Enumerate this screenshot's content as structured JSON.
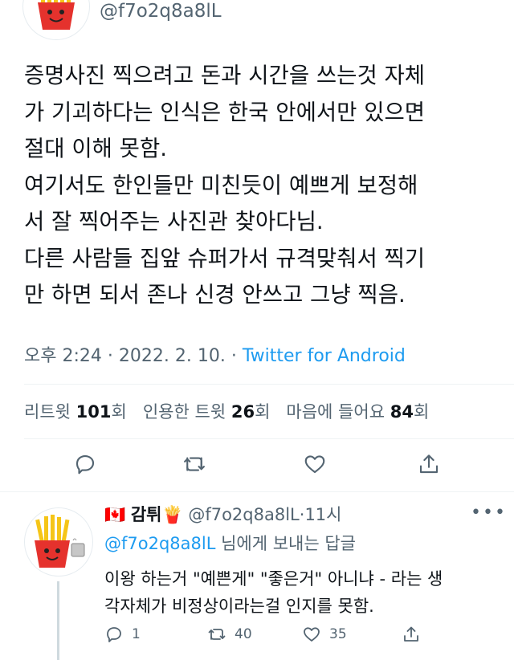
{
  "main_tweet": {
    "handle": "@f7o2q8a8lL",
    "body_lines": [
      "증명사진 찍으려고 돈과 시간을 쓰는것 자체",
      "가 기괴하다는 인식은 한국 안에서만 있으면",
      "절대 이해 못함.",
      "여기서도 한인들만 미친듯이 예쁘게 보정해",
      "서 잘 찍어주는 사진관 찾아다님.",
      "다른 사람들 집앞 슈퍼가서 규격맞춰서 찍기",
      "만 하면 되서 존나 신경 안쓰고 그냥 찍음."
    ],
    "time": "오후 2:24",
    "date": "2022. 2. 10.",
    "source": "Twitter for Android",
    "dot": "·",
    "stats": {
      "retweets_label": "리트윗",
      "retweets_count": "101",
      "quotes_label": "인용한 트윗",
      "quotes_count": "26",
      "likes_label": "마음에 들어요",
      "likes_count": "84",
      "unit": "회"
    },
    "actions": [
      "reply-icon",
      "retweet-icon",
      "like-icon",
      "share-icon"
    ]
  },
  "reply": {
    "flag": "🇨🇦",
    "display_name": "감튀",
    "name_emoji": "🍟",
    "handle": "@f7o2q8a8lL",
    "time": "11시",
    "dot": "·",
    "more": "•••",
    "replying_to_handle": "@f7o2q8a8lL",
    "replying_to_suffix": " 님에게 보내는 답글",
    "body_lines": [
      "이왕 하는거 \"예쁜게\"  \"좋은거\" 아니냐 - 라는 생",
      "각자체가 비정상이라는걸 인지를 못함."
    ],
    "actions": {
      "reply_count": "1",
      "retweet_count": "40",
      "like_count": "35"
    }
  },
  "colors": {
    "text": "#0f1419",
    "secondary": "#536471",
    "link": "#1d9bf0",
    "divider": "#eff3f4"
  }
}
